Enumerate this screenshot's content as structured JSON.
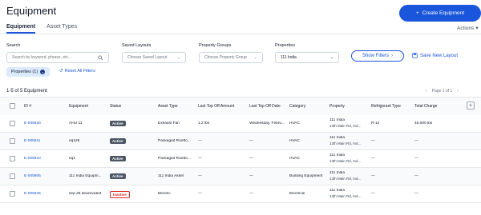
{
  "header": {
    "title": "Equipment",
    "create_label": "Create Equipment"
  },
  "tabs": [
    {
      "label": "Equipment",
      "active": true
    },
    {
      "label": "Asset Types",
      "active": false
    }
  ],
  "actions_label": "Actions",
  "filters": {
    "search": {
      "label": "Search",
      "placeholder": "Search by keyword, phrase, etc..."
    },
    "saved_layouts": {
      "label": "Saved Layouts",
      "value": "Choose Saved Layout"
    },
    "property_groups": {
      "label": "Property Groups",
      "value": "Choose Property Group"
    },
    "properties": {
      "label": "Properties",
      "value": "111 India"
    },
    "show_filters_label": "Show Filters",
    "save_layout_label": "Save New Layout",
    "chip_label": "Properties (1)",
    "reset_label": "Reset All Filters"
  },
  "results": {
    "count_text": "1-5 of 5 Equipment",
    "page_text": "Page 1 of 1"
  },
  "table": {
    "columns": [
      "ID #",
      "Equipment",
      "Status",
      "Asset Type",
      "Last Top Off Amount",
      "Last Top Off Date",
      "Category",
      "Property",
      "Refrigerant Type",
      "Total Charge"
    ],
    "rows": [
      {
        "id": "E-005830",
        "equipment": "AHU 11",
        "status": "Active",
        "asset_type": "Exhaust Fan",
        "amount": "1.2 lbs",
        "date": "Wednesday, Febru...",
        "category": "HVAC",
        "property": "111 India",
        "property2": "13th Main Rd, Ind...",
        "refrigerant": "R-12",
        "charge": "45.000 lbs"
      },
      {
        "id": "E-005911",
        "equipment": "eq125",
        "status": "Active",
        "asset_type": "Packaged Roofto...",
        "amount": "—",
        "date": "—",
        "category": "HVAC",
        "property": "111 India",
        "property2": "13th Main Rd, Ind...",
        "refrigerant": "—",
        "charge": "—"
      },
      {
        "id": "E-005910",
        "equipment": "eq1",
        "status": "Active",
        "asset_type": "Packaged Roofto...",
        "amount": "—",
        "date": "—",
        "category": "HVAC",
        "property": "111 India",
        "property2": "13th Main Rd, Ind...",
        "refrigerant": "—",
        "charge": "—"
      },
      {
        "id": "E-005906",
        "equipment": "111 India Equipm...",
        "status": "Active",
        "asset_type": "111 India Asset",
        "amount": "—",
        "date": "—",
        "category": "Building Equipment",
        "property": "111 India",
        "property2": "13th Main Rd, Ind...",
        "refrigerant": "—",
        "charge": "—"
      },
      {
        "id": "E-005845",
        "equipment": "sep 26 deactivated",
        "status": "Inactive",
        "asset_type": "Electric",
        "amount": "—",
        "date": "—",
        "category": "Electrical",
        "property": "111 India",
        "property2": "13th Main Rd, Ind...",
        "refrigerant": "—",
        "charge": "—"
      }
    ]
  },
  "colors": {
    "accent": "#1a56db",
    "inactive": "#dc2626",
    "active_badge": "#4b5563"
  }
}
